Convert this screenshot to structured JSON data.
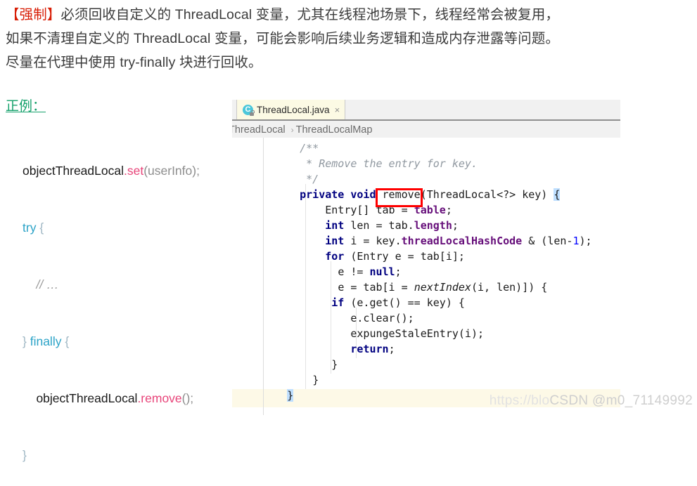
{
  "prose": {
    "mandatory_tag": "【强制】",
    "line1_rest": "必须回收自定义的 ThreadLocal 变量，尤其在线程池场景下，线程经常会被复用，",
    "line2": "如果不清理自定义的 ThreadLocal 变量，可能会影响后续业务逻辑和造成内存泄露等问题。",
    "line3": "尽量在代理中使用 try-finally 块进行回收。",
    "mandatory_color": "#d81e06",
    "text_color": "#3b3b3b"
  },
  "good_example": {
    "label": "正例：",
    "label_color": "#13a06a",
    "code": {
      "line1_ident": "objectThreadLocal",
      "line1_method": ".set",
      "line1_args": "(userInfo);",
      "line2_kw": "try",
      "line2_brace": " {",
      "line3_comment": "// …",
      "line4_brace_close": "} ",
      "line4_kw": "finally",
      "line4_brace_open": " {",
      "line5_ident": "objectThreadLocal",
      "line5_method": ".remove",
      "line5_args": "();",
      "line6_brace": "}"
    }
  },
  "ide": {
    "tab": {
      "filename": "ThreadLocal.java",
      "icon": "java-class-icon",
      "icon_letter": "C",
      "close_glyph": "×",
      "background": "#fcfae4"
    },
    "breadcrumb": {
      "items": [
        "ThreadLocal",
        "ThreadLocalMap"
      ],
      "separator": "›"
    }
  },
  "editor": {
    "highlight_box_target": "remove",
    "highlight_box_color": "#ff0000",
    "current_line_color": "#fdf9e7",
    "code_lines": [
      {
        "indent": 4,
        "parts": [
          {
            "t": "/**",
            "c": "cm"
          }
        ]
      },
      {
        "indent": 4,
        "parts": [
          {
            "t": " * Remove the entry for key.",
            "c": "cm"
          }
        ]
      },
      {
        "indent": 4,
        "parts": [
          {
            "t": " */",
            "c": "cm"
          }
        ]
      },
      {
        "indent": 4,
        "parts": [
          {
            "t": "private void ",
            "c": "kw"
          },
          {
            "t": "remove",
            "c": "pl"
          },
          {
            "t": "(ThreadLocal<?> key) ",
            "c": "pl"
          },
          {
            "t": "{",
            "c": "bracehl"
          }
        ]
      },
      {
        "indent": 8,
        "parts": [
          {
            "t": "Entry[] tab = ",
            "c": "pl"
          },
          {
            "t": "table",
            "c": "fld"
          },
          {
            "t": ";",
            "c": "pl"
          }
        ]
      },
      {
        "indent": 8,
        "parts": [
          {
            "t": "int",
            "c": "kw"
          },
          {
            "t": " len = tab.",
            "c": "pl"
          },
          {
            "t": "length",
            "c": "fld"
          },
          {
            "t": ";",
            "c": "pl"
          }
        ]
      },
      {
        "indent": 8,
        "parts": [
          {
            "t": "int",
            "c": "kw"
          },
          {
            "t": " i = key.",
            "c": "pl"
          },
          {
            "t": "threadLocalHashCode",
            "c": "fld"
          },
          {
            "t": " & (len-",
            "c": "pl"
          },
          {
            "t": "1",
            "c": "num"
          },
          {
            "t": ");",
            "c": "pl"
          }
        ]
      },
      {
        "indent": 8,
        "parts": [
          {
            "t": "for",
            "c": "kw"
          },
          {
            "t": " (Entry e = tab[i];",
            "c": "pl"
          }
        ]
      },
      {
        "indent": 10,
        "parts": [
          {
            "t": "e != ",
            "c": "pl"
          },
          {
            "t": "null",
            "c": "kw"
          },
          {
            "t": ";",
            "c": "pl"
          }
        ]
      },
      {
        "indent": 10,
        "parts": [
          {
            "t": "e = tab[i = ",
            "c": "pl"
          },
          {
            "t": "nextIndex",
            "c": "stat"
          },
          {
            "t": "(i, len)]) {",
            "c": "pl"
          }
        ]
      },
      {
        "indent": 9,
        "parts": [
          {
            "t": "if",
            "c": "kw"
          },
          {
            "t": " (e.get() == key) {",
            "c": "pl"
          }
        ]
      },
      {
        "indent": 12,
        "parts": [
          {
            "t": "e.clear();",
            "c": "pl"
          }
        ]
      },
      {
        "indent": 12,
        "parts": [
          {
            "t": "expungeStaleEntry(i);",
            "c": "pl"
          }
        ]
      },
      {
        "indent": 12,
        "parts": [
          {
            "t": "return",
            "c": "kw"
          },
          {
            "t": ";",
            "c": "pl"
          }
        ]
      },
      {
        "indent": 9,
        "parts": [
          {
            "t": "}",
            "c": "pl"
          }
        ]
      },
      {
        "indent": 6,
        "parts": [
          {
            "t": "}",
            "c": "pl"
          }
        ]
      },
      {
        "indent": 2,
        "parts": [
          {
            "t": "}",
            "c": "bracehl"
          }
        ]
      }
    ]
  },
  "watermark": {
    "url_fragment": "https://blo",
    "text": "CSDN @m0_71149992"
  }
}
